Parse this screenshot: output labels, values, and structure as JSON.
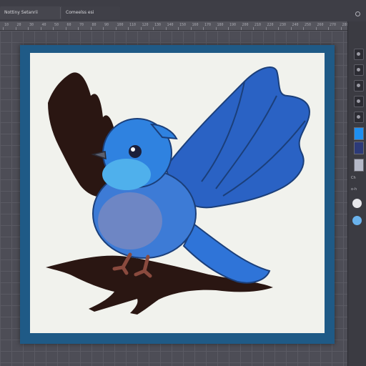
{
  "tabs": [
    {
      "label": "Nottiny Setanrii"
    },
    {
      "label": "Comeelss esi"
    }
  ],
  "ruler": {
    "ticks": [
      "10",
      "20",
      "30",
      "40",
      "50",
      "60",
      "70",
      "80",
      "90",
      "100",
      "110",
      "120",
      "130",
      "140",
      "150",
      "160",
      "170",
      "180",
      "190",
      "200",
      "210",
      "220",
      "230",
      "240",
      "250",
      "260",
      "270",
      "280"
    ]
  },
  "panel": {
    "labels": [
      "Ch",
      "o-h"
    ],
    "swatches": [
      "#1e8ff0",
      "#2c3a78",
      "#b5b9c8"
    ]
  },
  "colors": {
    "frame": "#1f5a86",
    "canvas": "#f1f2ed",
    "bird_blue": "#2f74d8",
    "bird_light": "#4fa8e8",
    "shadow": "#2a1612"
  },
  "icons": [
    "panel-toggle-icon",
    "layer-visibility-icon"
  ]
}
